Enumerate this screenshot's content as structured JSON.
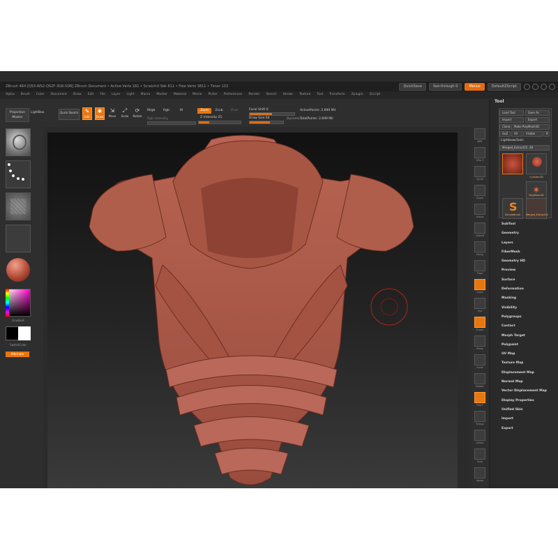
{
  "window": {
    "title": "ZBrush 4R4  [QS3-WS2-QS2F-3G8-5DB]  ZBrush Document    • Active Verts 181 • ScratchU Sbk 811 • Free Verts 3811 • Timer 133",
    "quicksave": "QuickSave",
    "see_through": "See-through   0",
    "menus_btn": "Menus",
    "default_zscript": "DefaultZScript"
  },
  "menubar": [
    "Alpha",
    "Brush",
    "Color",
    "Document",
    "Draw",
    "Edit",
    "File",
    "Layer",
    "Light",
    "Macro",
    "Marker",
    "Material",
    "Movie",
    "Picker",
    "Preferences",
    "Render",
    "Stencil",
    "Stroke",
    "Texture",
    "Tool",
    "Transform",
    "Zplugin",
    "Zscript"
  ],
  "shelf": {
    "projection_master": "Projection Master",
    "lightbox": "LightBox",
    "quick_sketch": "Quick Sketch",
    "edit": "Edit",
    "draw": "Draw",
    "move": "Move",
    "scale": "Scale",
    "rotate": "Rotate",
    "mrgb": "Mrgb",
    "rgb": "Rgb",
    "m": "M",
    "rgb_intensity": "Rgb Intensity",
    "zadd": "Zadd",
    "zsub": "Zsub",
    "zcut": "Zcut",
    "z_intensity": "Z Intensity 25",
    "focal_shift": "Focal Shift 0",
    "draw_size": "Draw Size 64",
    "dynamic": "Dynamic",
    "active_points": "ActivePoints: 2.699 Mil",
    "total_points": "TotalPoints: 2.699 Mil"
  },
  "left_shelf": {
    "color_label": "Gradient",
    "switch_label": "SwitchColor",
    "alternate": "Alternate"
  },
  "right_strip": [
    "BPR",
    "SPix 3",
    "Scroll",
    "Zoom",
    "Actual",
    "AAHalf",
    "Persp",
    "Floor",
    "Local",
    "Xyz",
    "Frame",
    "Move",
    "Scale",
    "Rotate",
    "PolyF",
    "Transp",
    "Ghost",
    "Solo",
    "Xpose"
  ],
  "tool_panel": {
    "title": "Tool",
    "load_tool": "Load Tool",
    "save_as": "Save As",
    "import": "Import",
    "export": "Export",
    "clone": "Clone",
    "make_polymesh": "Make PolyMesh3D",
    "goz": "GoZ",
    "all": "All",
    "visible": "Visible",
    "r": "R",
    "lightbox_tools": "Lightbox▸Tools",
    "current_tool": "Merged_Extract15. 48",
    "tools": [
      "Merged_Extract15",
      "Cylinder3D",
      "PolyMesh3D",
      "SimpleBrush",
      "Merged_Extract15"
    ],
    "sections": [
      "SubTool",
      "Geometry",
      "Layers",
      "FiberMesh",
      "Geometry HD",
      "Preview",
      "Surface",
      "Deformation",
      "Masking",
      "Visibility",
      "Polygroups",
      "Contact",
      "Morph Target",
      "Polypaint",
      "UV Map",
      "Texture Map",
      "Displacement Map",
      "Normal Map",
      "Vector Displacement Map",
      "Display Properties",
      "Unified Skin",
      "Import",
      "Export"
    ]
  },
  "colors": {
    "accent": "#e8760f",
    "model": "#b25a4a",
    "panel": "#2b2b2b"
  }
}
